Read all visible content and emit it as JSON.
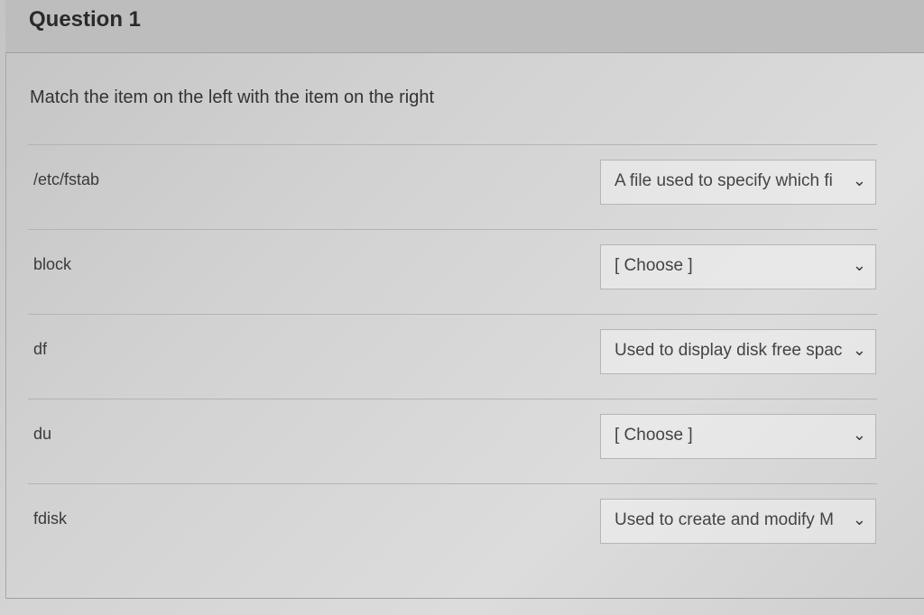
{
  "question": {
    "title": "Question 1",
    "prompt": "Match the item on the left with the item on the right"
  },
  "rows": [
    {
      "term": "/etc/fstab",
      "selected": "A file used to specify which fi"
    },
    {
      "term": "block",
      "selected": "[ Choose ]"
    },
    {
      "term": "df",
      "selected": "Used to display disk free spac"
    },
    {
      "term": "du",
      "selected": "[ Choose ]"
    },
    {
      "term": "fdisk",
      "selected": "Used to create and modify M"
    }
  ]
}
